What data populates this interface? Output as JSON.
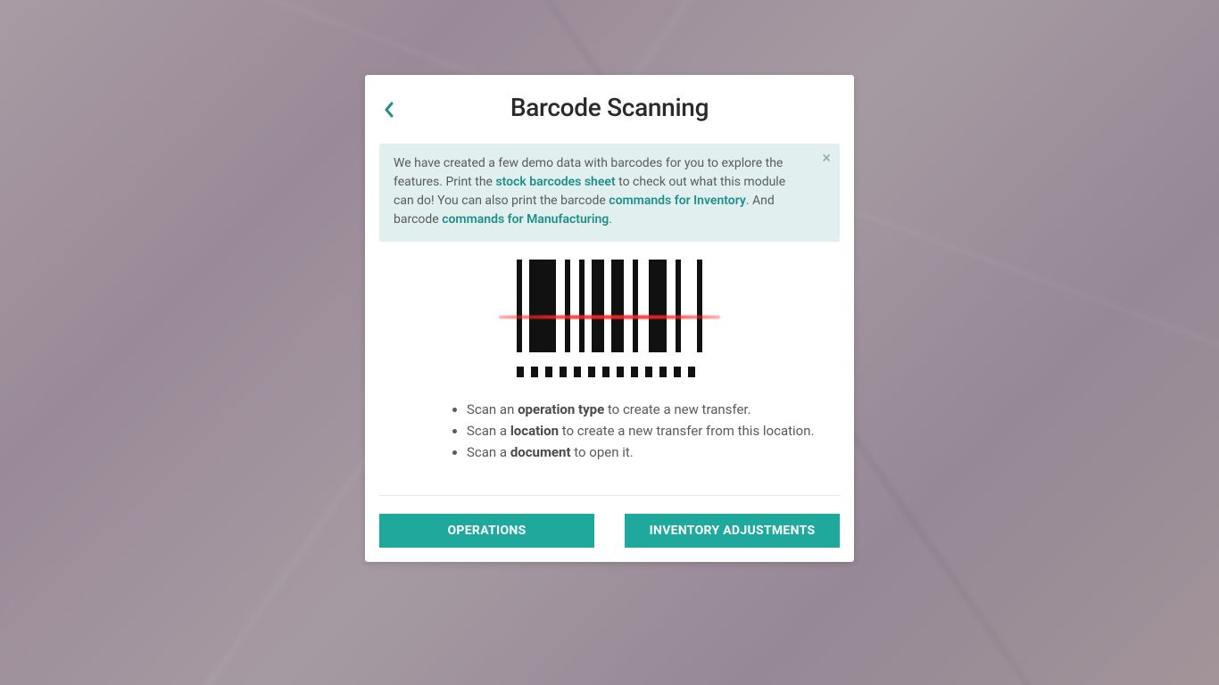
{
  "header": {
    "title": "Barcode Scanning"
  },
  "alert": {
    "text_1": "We have created a few demo data with barcodes for you to explore the features. Print the ",
    "link_1": "stock barcodes sheet",
    "text_2": " to check out what this module can do! You can also print the barcode ",
    "link_2": "commands for Inventory",
    "text_3": ". And barcode ",
    "link_3": "commands for Manufacturing",
    "text_4": "."
  },
  "instructions": {
    "items": [
      {
        "prefix": "Scan an ",
        "bold": "operation type",
        "suffix": " to create a new transfer."
      },
      {
        "prefix": "Scan a ",
        "bold": "location",
        "suffix": " to create a new transfer from this location."
      },
      {
        "prefix": "Scan a ",
        "bold": "document",
        "suffix": " to open it."
      }
    ]
  },
  "actions": {
    "operations": "OPERATIONS",
    "inventory_adjustments": "INVENTORY ADJUSTMENTS"
  }
}
